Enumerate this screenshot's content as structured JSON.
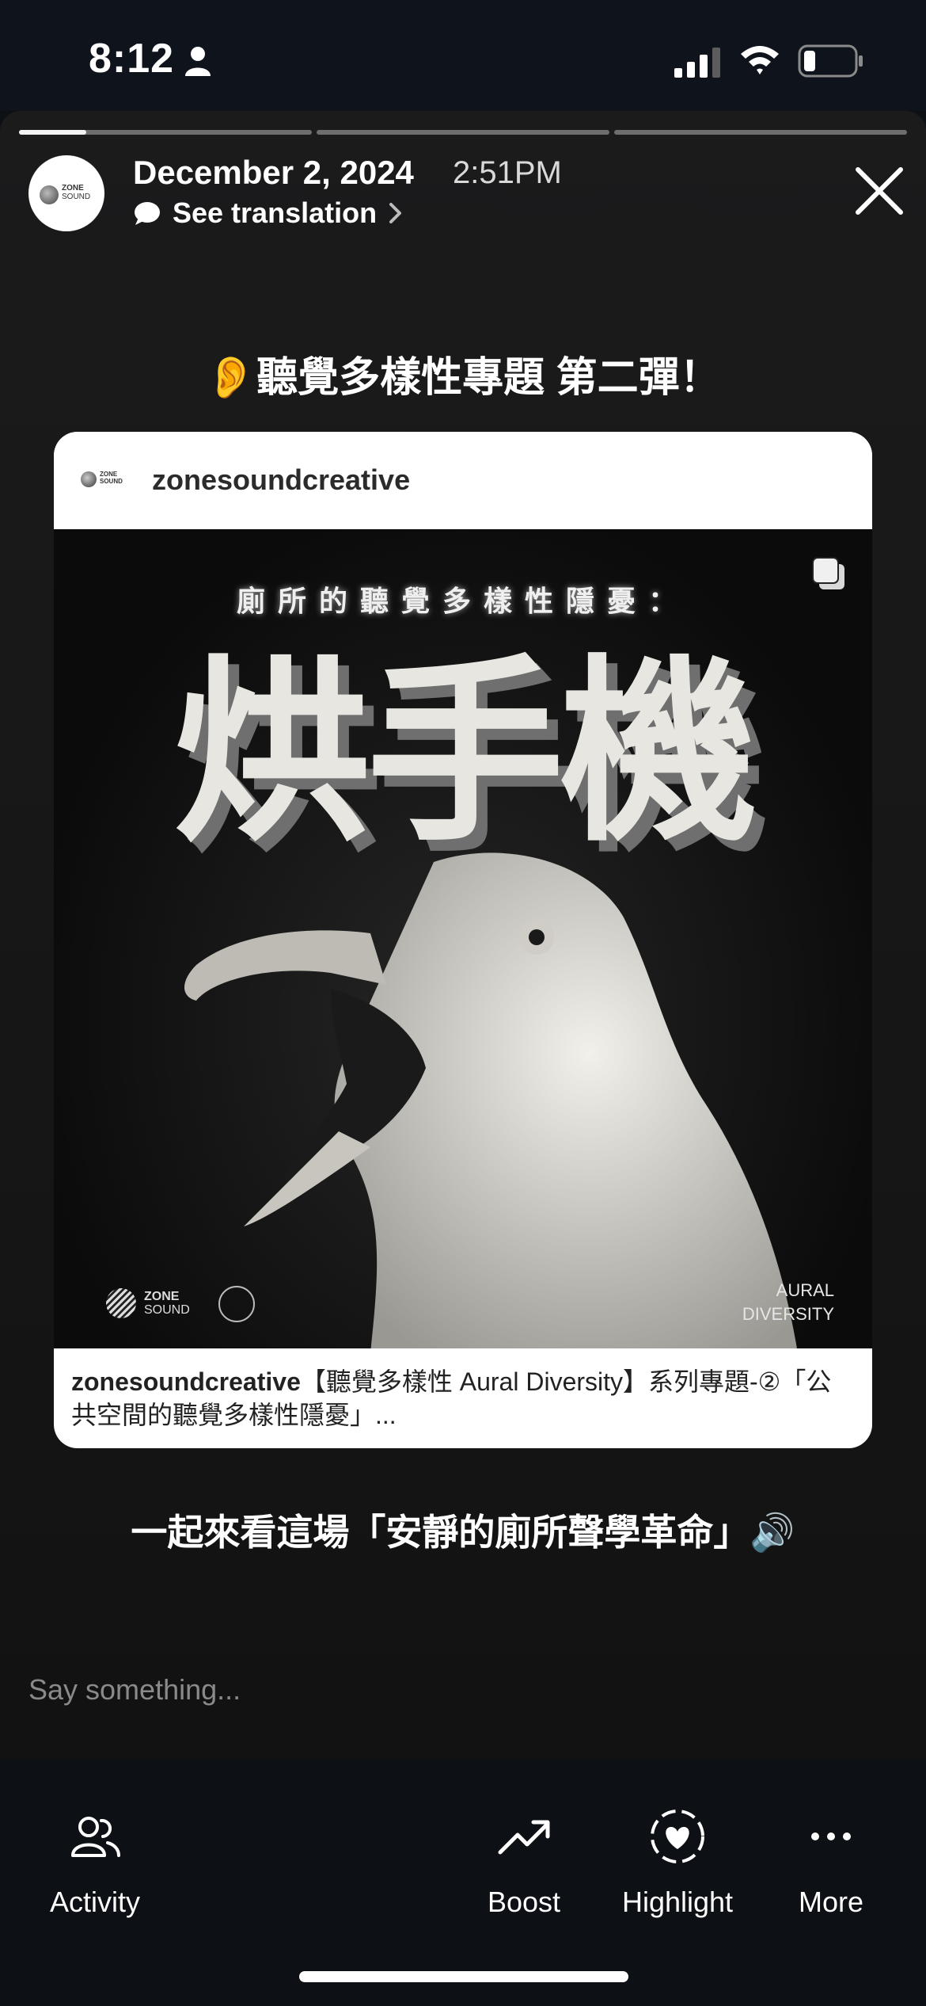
{
  "status_bar": {
    "time": "8:12"
  },
  "story": {
    "segments": [
      {
        "progress": 0.23
      },
      {
        "progress": 0
      },
      {
        "progress": 0
      }
    ],
    "date": "December 2, 2024",
    "time": "2:51PM",
    "translate_label": "See translation",
    "headline": "👂聽覺多樣性專題 第二彈！",
    "subline": "一起來看這場「安靜的廁所聲學革命」🔊",
    "reply_placeholder": "Say something..."
  },
  "avatar_logo": {
    "line1": "ZONE",
    "line2": "SOUND"
  },
  "card": {
    "username": "zonesoundcreative",
    "poster": {
      "subtitle": "廁所的聽覺多樣性隱憂：",
      "title": "烘手機",
      "logo_line1": "ZONE",
      "logo_line2": "SOUND",
      "corner_line1": "AURAL",
      "corner_line2": "DIVERSITY"
    },
    "caption_user": "zonesoundcreative",
    "caption_text": "【聽覺多樣性 Aural Diversity】系列專題-②「公共空間的聽覺多樣性隱憂」..."
  },
  "toolbar": {
    "activity": "Activity",
    "boost": "Boost",
    "highlight": "Highlight",
    "more": "More"
  }
}
